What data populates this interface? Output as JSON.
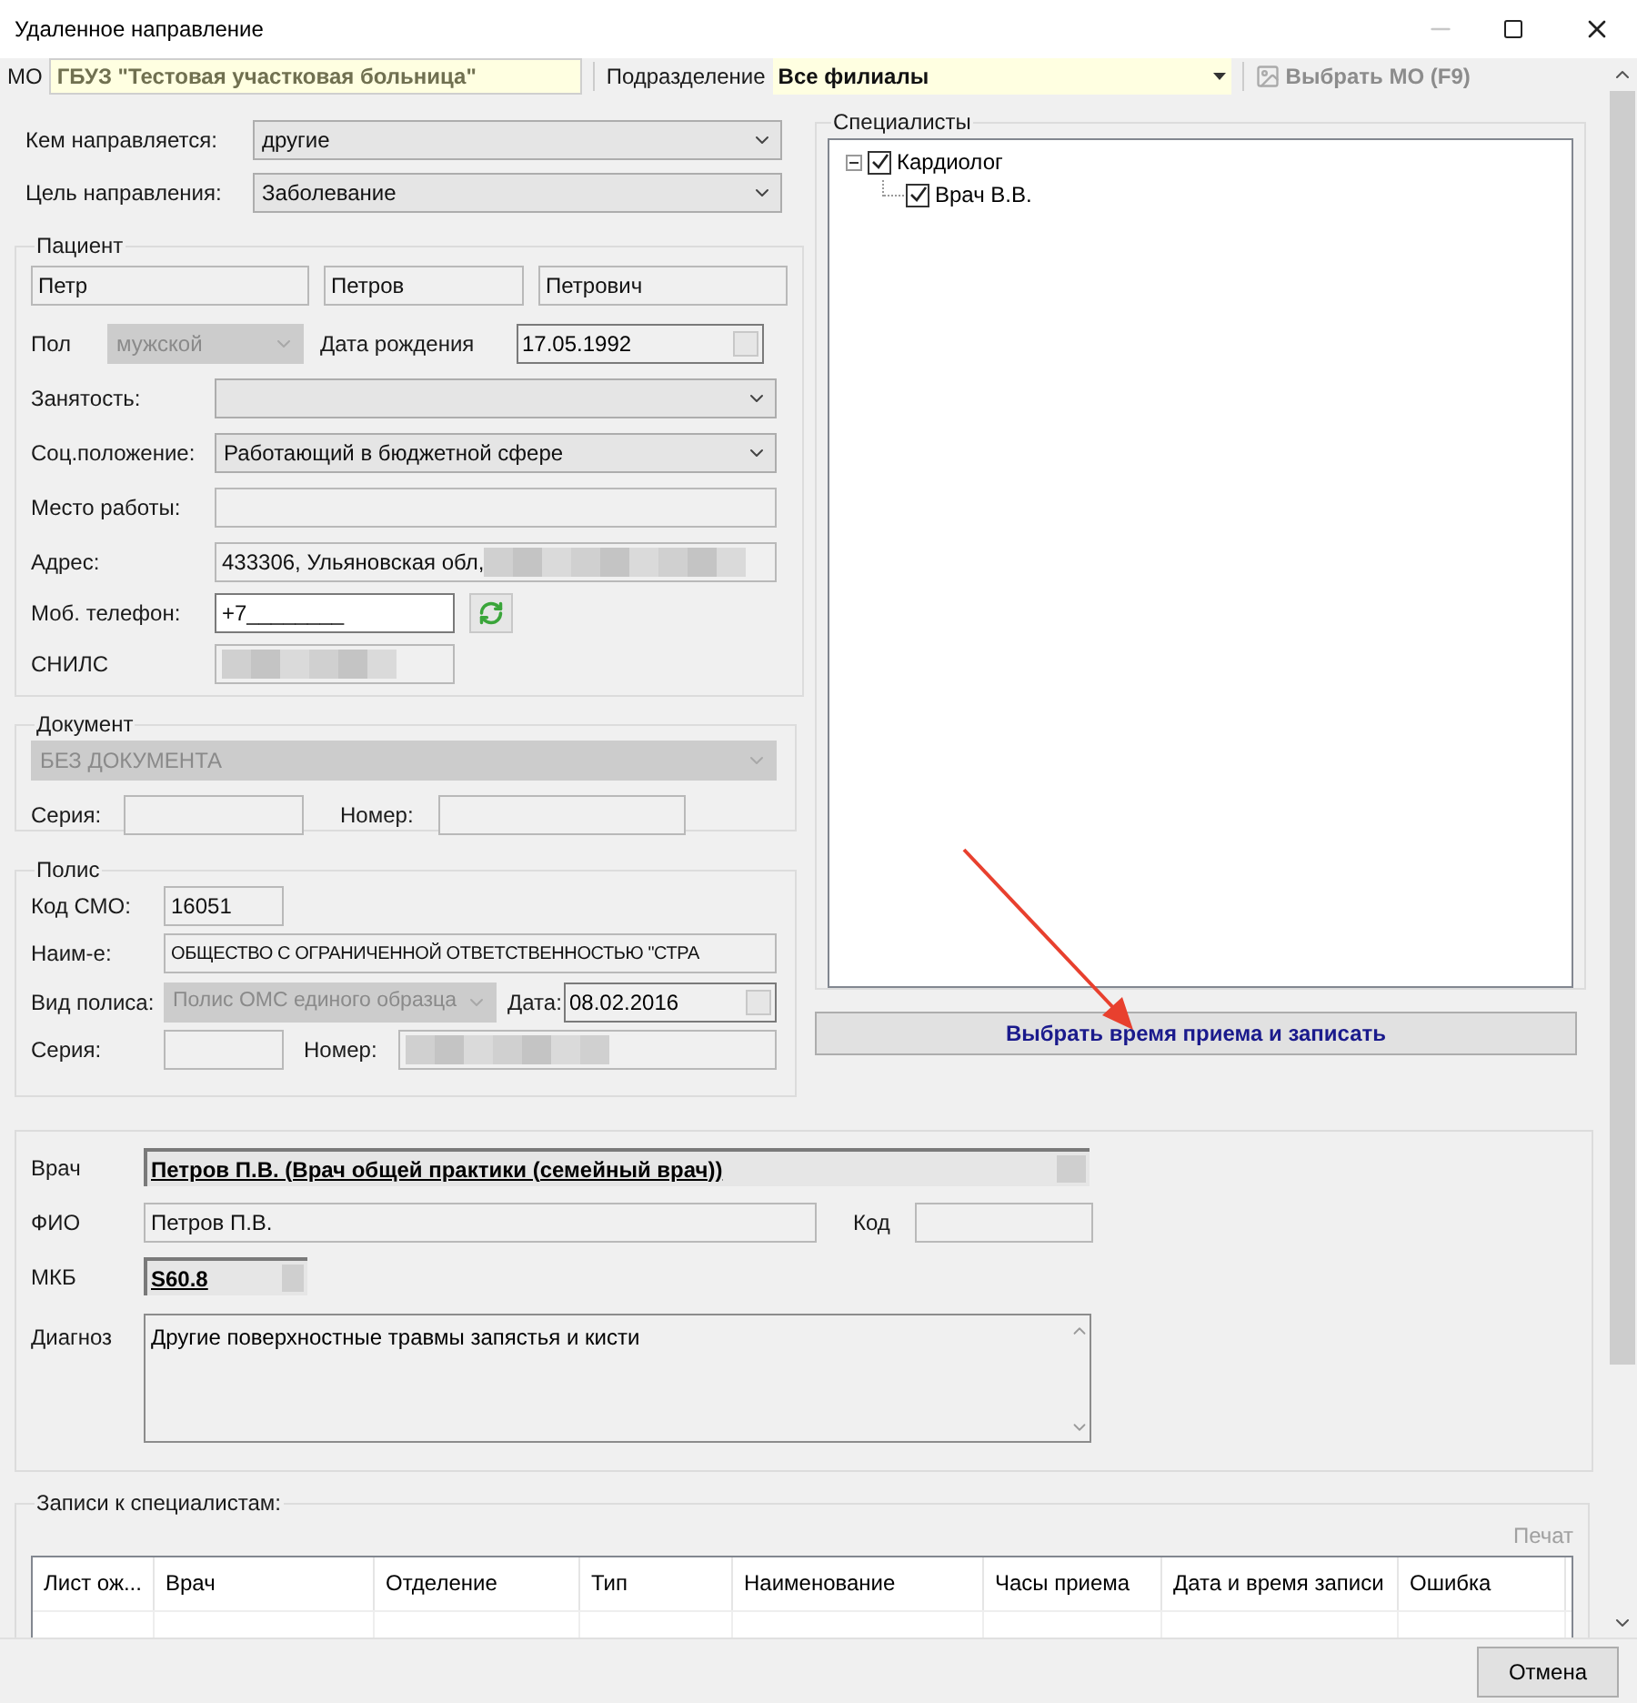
{
  "window": {
    "title": "Удаленное направление"
  },
  "toolbar": {
    "mo": {
      "label": "МО",
      "value": "ГБУЗ \"Тестовая участковая больница\""
    },
    "division": {
      "label": "Подразделение",
      "value": "Все филиалы"
    },
    "select_mo": {
      "label": "Выбрать МО (F9)",
      "disabled": true
    }
  },
  "referral": [
    {
      "label": "Кем направляется:",
      "value": "другие"
    },
    {
      "label": "Цель направления:",
      "value": "Заболевание"
    }
  ],
  "patient": {
    "title": "Пациент",
    "first_name": "Петр",
    "last_name": "Петров",
    "middle_name": "Петрович",
    "sex": {
      "label": "Пол",
      "value": "мужской",
      "disabled": true
    },
    "birth_date": {
      "label": "Дата рождения",
      "value": "17.05.1992"
    },
    "employment": {
      "label": "Занятость:"
    },
    "social_status": {
      "label": "Соц.положение:",
      "value": "Работающий в бюджетной сфере"
    },
    "workplace": {
      "label": "Место работы:"
    },
    "address": {
      "label": "Адрес:",
      "value": "433306, Ульяновская обл,"
    },
    "phone": {
      "label": "Моб. телефон:",
      "value": "+7________"
    },
    "snils": {
      "label": "СНИЛС"
    }
  },
  "document": {
    "title": "Документ",
    "type": {
      "value": "БЕЗ ДОКУМЕНТА",
      "disabled": true
    },
    "series": {
      "label": "Серия:"
    },
    "number": {
      "label": "Номер:"
    }
  },
  "policy": {
    "title": "Полис",
    "smo_code": {
      "label": "Код СМО:",
      "value": "16051"
    },
    "name": {
      "label": "Наим-е:",
      "value": "ОБЩЕСТВО С ОГРАНИЧЕННОЙ ОТВЕТСТВЕННОСТЬЮ \"СТРА"
    },
    "type": {
      "label": "Вид полиса:",
      "value": "Полис ОМС единого образца",
      "disabled": true
    },
    "date": {
      "label": "Дата:",
      "value": "08.02.2016"
    },
    "series": {
      "label": "Серия:"
    },
    "number": {
      "label": "Номер:"
    }
  },
  "specialists": {
    "title": "Специалисты",
    "tree": [
      {
        "label": "Кардиолог",
        "checked": true,
        "expanded": true,
        "children": [
          {
            "label": "Врач В.В.",
            "checked": true
          }
        ]
      }
    ]
  },
  "book_button": "Выбрать время приема и записать",
  "doctor": {
    "doctor": {
      "label": "Врач",
      "value": "Петров П.В. (Врач общей практики (семейный врач))"
    },
    "fio": {
      "label": "ФИО",
      "value": "Петров П.В."
    },
    "code": {
      "label": "Код"
    },
    "mkb": {
      "label": "МКБ",
      "value": "S60.8"
    },
    "diagnosis": {
      "label": "Диагноз",
      "value": "Другие поверхностные травмы запястья и кисти"
    }
  },
  "records": {
    "title": "Записи к специалистам:",
    "print": {
      "label": "Печат",
      "disabled": true
    },
    "columns": [
      "Лист ож...",
      "Врач",
      "Отделение",
      "Тип",
      "Наименование",
      "Часы приема",
      "Дата и время записи",
      "Ошибка"
    ]
  },
  "buttons": {
    "cancel": "Отмена"
  }
}
